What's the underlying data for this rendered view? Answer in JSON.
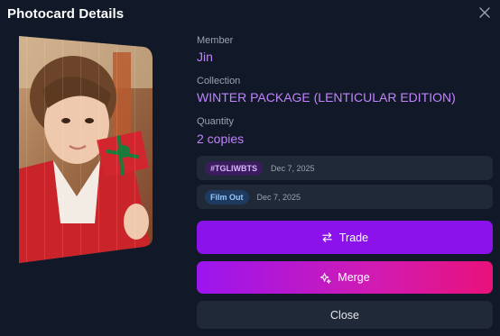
{
  "dialog": {
    "title": "Photocard Details",
    "close_icon": "close-icon"
  },
  "photocard": {
    "image_icon": "photocard-image"
  },
  "member": {
    "label": "Member",
    "value": "Jin"
  },
  "collection": {
    "label": "Collection",
    "value": "WINTER PACKAGE (LENTICULAR EDITION)"
  },
  "quantity": {
    "label": "Quantity",
    "value": "2 copies"
  },
  "copies": [
    {
      "tag": "#TGLIWBTS",
      "date": "Dec 7, 2025",
      "tag_color": "#d8b4fe"
    },
    {
      "tag": "Film Out",
      "date": "Dec 7, 2025",
      "tag_color": "#93c5fd"
    }
  ],
  "actions": {
    "trade_label": "Trade",
    "trade_icon": "swap-arrows-icon",
    "merge_label": "Merge",
    "merge_icon": "sparkles-icon",
    "close_label": "Close"
  },
  "colors": {
    "background": "#111827",
    "accent_purple": "#8b12ea",
    "merge_gradient_end": "#e9117c",
    "value_text": "#c084fc"
  }
}
